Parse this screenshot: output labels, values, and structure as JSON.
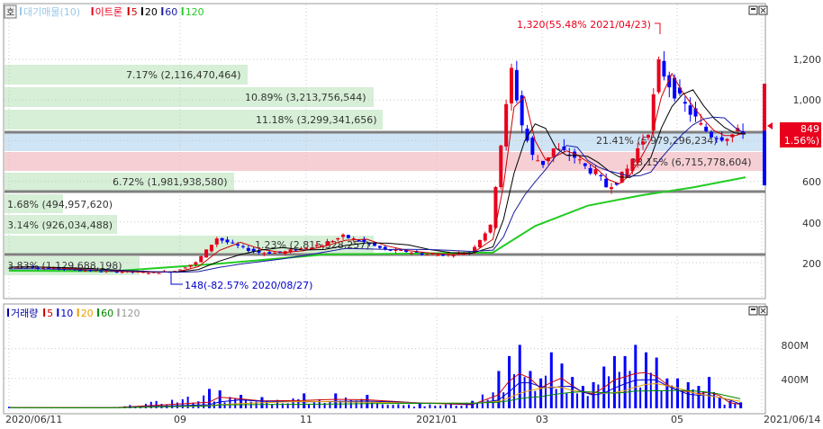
{
  "colors": {
    "up": "#e8001c",
    "down": "#0000ff",
    "ma5": "#cc0000",
    "ma20": "#000000",
    "ma60": "#1a1aa0",
    "ma120": "#22cc22",
    "vol5": "#cc0000",
    "vol10": "#0000cc",
    "vol20": "#e8a000",
    "vol60": "#008800",
    "vol120": "#999999",
    "profileGreen": "#d6efd6",
    "profileBlue": "#cfe4f5",
    "profileRed": "#f6cfd4",
    "hline": "#808080",
    "grid": "#c8c8c8",
    "priceTag": "#e8001c",
    "annotRed": "#e8001c",
    "annotBlue": "#0000cc"
  },
  "price_legend": {
    "icon": "호",
    "items": [
      {
        "label": "대기매물(10)",
        "color": "#9ac8e8"
      },
      {
        "label": "이트론",
        "color": "#e8001c"
      },
      {
        "label": "5",
        "color": "#cc0000"
      },
      {
        "label": "20",
        "color": "#000000"
      },
      {
        "label": "60",
        "color": "#1a1aa0"
      },
      {
        "label": "120",
        "color": "#22cc22"
      }
    ]
  },
  "volume_legend": {
    "items": [
      {
        "label": "거래량",
        "color": "#0000aa"
      },
      {
        "label": "5",
        "color": "#cc0000"
      },
      {
        "label": "10",
        "color": "#0000cc"
      },
      {
        "label": "20",
        "color": "#e8a000"
      },
      {
        "label": "60",
        "color": "#008800"
      },
      {
        "label": "120",
        "color": "#999999"
      }
    ]
  },
  "x_labels": [
    "2020/06/11",
    "09",
    "11",
    "2021/01",
    "03",
    "05",
    "2021/06/14"
  ],
  "price_axis": [
    "1,200",
    "1,000",
    "800",
    "600",
    "400",
    "200"
  ],
  "volume_axis": [
    "800M",
    "400M"
  ],
  "current_price": {
    "value": "849",
    "change": "( 1.56%)"
  },
  "annotations": {
    "high": "1,320(55.48% 2021/04/23)",
    "low": "148(-82.57% 2020/08/27)",
    "mid": "21.41% (6,979,296,234)",
    "red_zone": "28.15% (6,715,778,604)",
    "small": "1,23% (2,815,328,257)"
  },
  "chart_data": [
    {
      "type": "candlestick",
      "title": "이트론",
      "x_range": [
        "2020/06/11",
        "2021/06/14"
      ],
      "y_range": [
        120,
        1420
      ],
      "yticks": [
        200,
        400,
        600,
        800,
        1000,
        1200
      ],
      "last": 849,
      "last_change_pct": 1.56,
      "high": {
        "price": 1320,
        "pct": 55.48,
        "date": "2021/04/23"
      },
      "low": {
        "price": 148,
        "pct": -82.57,
        "date": "2020/08/27"
      },
      "moving_averages": [
        5,
        20,
        60,
        120
      ],
      "horizontal_lines": [
        830,
        555,
        245
      ],
      "resistance_profile": {
        "name": "대기매물(10)",
        "bins": [
          {
            "pct": 7.17,
            "volume": "2,116,470,464",
            "zone": "green"
          },
          {
            "pct": 10.89,
            "volume": "3,213,756,544",
            "zone": "green"
          },
          {
            "pct": 11.18,
            "volume": "3,299,341,656",
            "zone": "green"
          },
          {
            "pct": 21.41,
            "volume": "6,979,296,234",
            "zone": "blue"
          },
          {
            "pct": 28.15,
            "volume": "6,715,778,604",
            "zone": "red"
          },
          {
            "pct": 6.72,
            "volume": "1,981,938,580",
            "zone": "green"
          },
          {
            "pct": 1.68,
            "volume": "494,957,620",
            "zone": "green"
          },
          {
            "pct": 3.14,
            "volume": "926,034,488",
            "zone": "green"
          },
          {
            "pct": 1.23,
            "volume": "2,815,328,257",
            "zone": "green"
          },
          {
            "pct": 3.83,
            "volume": "1,129,688,198",
            "zone": "green"
          }
        ]
      },
      "series": [
        {
          "name": "이트론",
          "role": "close",
          "points": [
            [
              0,
              178
            ],
            [
              4,
              180
            ],
            [
              8,
              172
            ],
            [
              12,
              168
            ],
            [
              16,
              160
            ],
            [
              20,
              156
            ],
            [
              24,
              154
            ],
            [
              28,
              150
            ],
            [
              32,
              160
            ],
            [
              36,
              200
            ],
            [
              40,
              320
            ],
            [
              44,
              280
            ],
            [
              48,
              250
            ],
            [
              52,
              248
            ],
            [
              56,
              270
            ],
            [
              60,
              290
            ],
            [
              64,
              330
            ],
            [
              68,
              300
            ],
            [
              72,
              262
            ],
            [
              76,
              255
            ],
            [
              80,
              240
            ],
            [
              84,
              240
            ],
            [
              88,
              250
            ],
            [
              92,
              380
            ],
            [
              94,
              780
            ],
            [
              96,
              1150
            ],
            [
              98,
              880
            ],
            [
              100,
              720
            ],
            [
              102,
              690
            ],
            [
              104,
              760
            ],
            [
              106,
              740
            ],
            [
              108,
              720
            ],
            [
              110,
              670
            ],
            [
              112,
              640
            ],
            [
              114,
              575
            ],
            [
              116,
              600
            ],
            [
              118,
              660
            ],
            [
              120,
              760
            ],
            [
              122,
              850
            ],
            [
              124,
              1180
            ],
            [
              126,
              1080
            ],
            [
              128,
              1000
            ],
            [
              130,
              940
            ],
            [
              132,
              870
            ],
            [
              134,
              830
            ],
            [
              136,
              820
            ],
            [
              138,
              830
            ],
            [
              140,
              849
            ]
          ]
        },
        {
          "name": "120",
          "role": "ma",
          "points": [
            [
              0,
              160
            ],
            [
              20,
              158
            ],
            [
              40,
              195
            ],
            [
              60,
              240
            ],
            [
              80,
              245
            ],
            [
              92,
              250
            ],
            [
              100,
              380
            ],
            [
              110,
              480
            ],
            [
              120,
              530
            ],
            [
              130,
              570
            ],
            [
              140,
              620
            ]
          ]
        }
      ]
    },
    {
      "type": "bar",
      "title": "거래량",
      "x_range": [
        "2020/06/11",
        "2021/06/14"
      ],
      "y_range": [
        0,
        1050
      ],
      "unit": "M",
      "yticks": [
        400,
        800
      ],
      "values_by_period": [
        [
          0,
          20
        ],
        [
          10,
          15
        ],
        [
          20,
          15
        ],
        [
          38,
          260
        ],
        [
          40,
          240
        ],
        [
          44,
          180
        ],
        [
          48,
          150
        ],
        [
          56,
          200
        ],
        [
          62,
          200
        ],
        [
          68,
          180
        ],
        [
          78,
          60
        ],
        [
          88,
          100
        ],
        [
          93,
          500
        ],
        [
          95,
          700
        ],
        [
          97,
          850
        ],
        [
          99,
          500
        ],
        [
          101,
          400
        ],
        [
          103,
          750
        ],
        [
          105,
          600
        ],
        [
          107,
          420
        ],
        [
          109,
          300
        ],
        [
          111,
          350
        ],
        [
          113,
          560
        ],
        [
          115,
          700
        ],
        [
          117,
          700
        ],
        [
          119,
          850
        ],
        [
          121,
          750
        ],
        [
          123,
          680
        ],
        [
          125,
          400
        ],
        [
          127,
          400
        ],
        [
          129,
          350
        ],
        [
          131,
          300
        ],
        [
          133,
          420
        ],
        [
          135,
          150
        ],
        [
          137,
          100
        ],
        [
          139,
          80
        ]
      ]
    }
  ]
}
